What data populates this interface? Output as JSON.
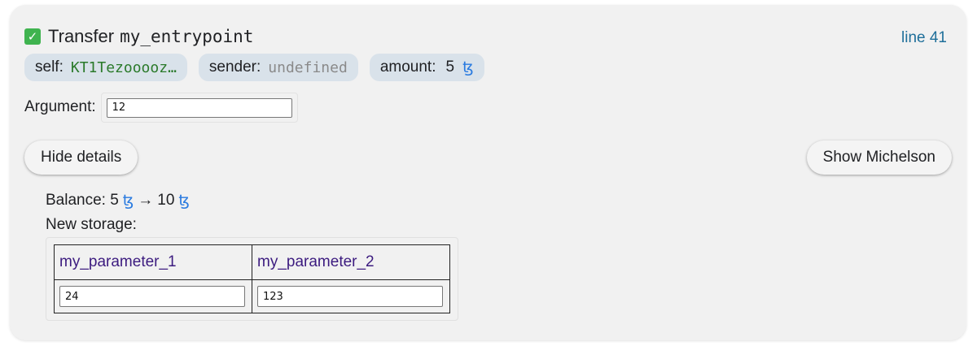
{
  "header": {
    "title_prefix": "Transfer",
    "entrypoint": "my_entrypoint",
    "line_link": "line 41"
  },
  "chips": {
    "self_label": "self:",
    "self_value": "KT1Tezooooz…",
    "sender_label": "sender:",
    "sender_value": "undefined",
    "amount_label": "amount:",
    "amount_value": "5",
    "tez_symbol": "ꜩ"
  },
  "argument": {
    "label": "Argument:",
    "value": "12"
  },
  "buttons": {
    "hide_details": "Hide details",
    "show_michelson": "Show Michelson"
  },
  "details": {
    "balance_label": "Balance: 5",
    "balance_new": "10",
    "arrow": "→",
    "new_storage_label": "New storage:"
  },
  "storage_table": {
    "headers": [
      "my_parameter_1",
      "my_parameter_2"
    ],
    "values": [
      "24",
      "123"
    ]
  },
  "colors": {
    "card_bg": "#f1f1f1",
    "chip_bg": "#d9e2ea",
    "address_green": "#2b7a2b",
    "tez_blue": "#2a7be0",
    "link_blue": "#1f6f9a",
    "header_purple": "#3c1b7f",
    "check_green": "#3fb34f"
  },
  "icons": {
    "check": "check-mark-icon"
  }
}
